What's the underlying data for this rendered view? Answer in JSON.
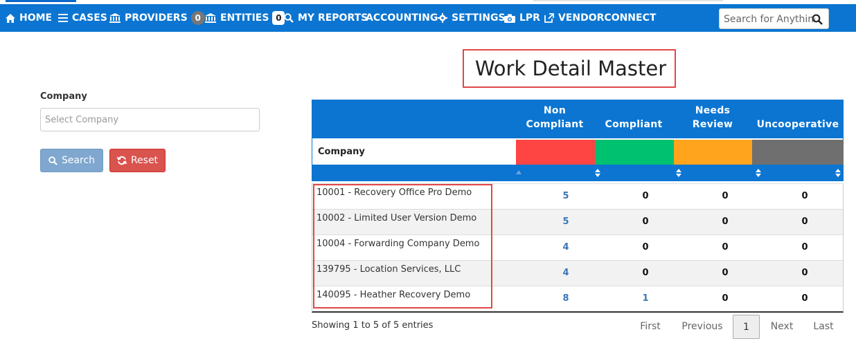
{
  "nav": {
    "items": [
      {
        "label": "HOME",
        "icon": "home-icon"
      },
      {
        "label": "CASES",
        "icon": "menu-icon"
      },
      {
        "label": "PROVIDERS",
        "icon": "bank-icon",
        "badge": "0"
      },
      {
        "label": "ENTITIES",
        "icon": "bank-icon",
        "badge": "0"
      },
      {
        "label": "MY REPORTS",
        "icon": "search-icon"
      },
      {
        "label": "ACCOUNTING"
      },
      {
        "label": "SETTINGS",
        "icon": "gear-icon"
      },
      {
        "label": "LPR",
        "icon": "camera-icon"
      },
      {
        "label": "VENDORCONNECT",
        "icon": "external-link-icon"
      }
    ],
    "search_placeholder": "Search for Anything"
  },
  "filter": {
    "company_label": "Company",
    "company_placeholder": "Select Company",
    "search_button": "Search",
    "reset_button": "Reset"
  },
  "page_title": "Work Detail Master",
  "table": {
    "headers": {
      "non_compliant_line1": "Non",
      "non_compliant_line2": "Compliant",
      "compliant": "Compliant",
      "needs_review_line1": "Needs",
      "needs_review_line2": "Review",
      "uncooperative": "Uncooperative"
    },
    "company_column": "Company",
    "status_colors": {
      "non_compliant": "#ff4444",
      "compliant": "#00c170",
      "needs_review": "#ffa41c",
      "uncooperative": "#6f6f6f"
    },
    "rows": [
      {
        "company": "10001 - Recovery Office Pro Demo",
        "non_compliant": "5",
        "compliant": "0",
        "needs_review": "0",
        "uncooperative": "0"
      },
      {
        "company": "10002 - Limited User Version Demo",
        "non_compliant": "5",
        "compliant": "0",
        "needs_review": "0",
        "uncooperative": "0"
      },
      {
        "company": "10004 - Forwarding Company Demo",
        "non_compliant": "4",
        "compliant": "0",
        "needs_review": "0",
        "uncooperative": "0"
      },
      {
        "company": "139795 - Location Services, LLC",
        "non_compliant": "4",
        "compliant": "0",
        "needs_review": "0",
        "uncooperative": "0"
      },
      {
        "company": "140095 - Heather Recovery Demo",
        "non_compliant": "8",
        "compliant": "1",
        "needs_review": "0",
        "uncooperative": "0"
      }
    ]
  },
  "footer": {
    "info": "Showing 1 to 5 of 5 entries",
    "first": "First",
    "previous": "Previous",
    "page": "1",
    "next": "Next",
    "last": "Last"
  }
}
